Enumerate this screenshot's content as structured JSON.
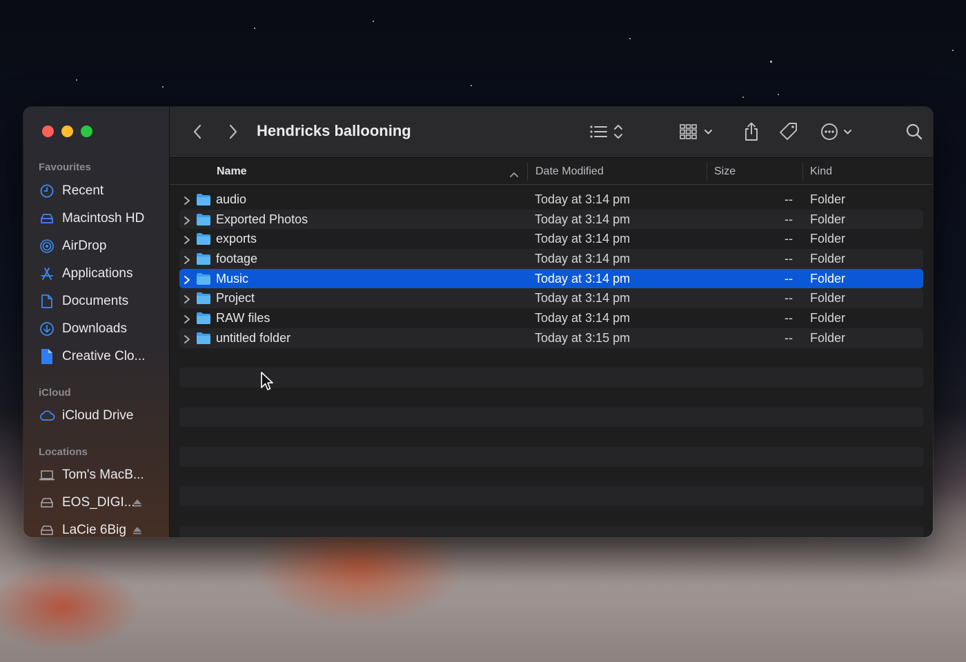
{
  "window": {
    "title": "Hendricks ballooning"
  },
  "sidebar": {
    "sections": [
      {
        "title": "Favourites",
        "items": [
          {
            "label": "Recent",
            "icon": "clock-icon"
          },
          {
            "label": "Macintosh HD",
            "icon": "drive-icon"
          },
          {
            "label": "AirDrop",
            "icon": "airdrop-icon"
          },
          {
            "label": "Applications",
            "icon": "applications-icon"
          },
          {
            "label": "Documents",
            "icon": "document-icon"
          },
          {
            "label": "Downloads",
            "icon": "download-icon"
          },
          {
            "label": "Creative Clo...",
            "icon": "file-icon"
          }
        ]
      },
      {
        "title": "iCloud",
        "items": [
          {
            "label": "iCloud Drive",
            "icon": "cloud-icon"
          }
        ]
      },
      {
        "title": "Locations",
        "items": [
          {
            "label": "Tom's MacB...",
            "icon": "laptop-icon"
          },
          {
            "label": "EOS_DIGI...",
            "icon": "drive-icon",
            "eject": true
          },
          {
            "label": "LaCie 6Big",
            "icon": "drive-icon",
            "eject": true
          }
        ]
      }
    ]
  },
  "columns": {
    "name": "Name",
    "date": "Date Modified",
    "size": "Size",
    "kind": "Kind"
  },
  "files": [
    {
      "name": "audio",
      "date": "Today at 3:14 pm",
      "size": "--",
      "kind": "Folder"
    },
    {
      "name": "Exported Photos",
      "date": "Today at 3:14 pm",
      "size": "--",
      "kind": "Folder"
    },
    {
      "name": "exports",
      "date": "Today at 3:14 pm",
      "size": "--",
      "kind": "Folder"
    },
    {
      "name": "footage",
      "date": "Today at 3:14 pm",
      "size": "--",
      "kind": "Folder"
    },
    {
      "name": "Music",
      "date": "Today at 3:14 pm",
      "size": "--",
      "kind": "Folder",
      "selected": true
    },
    {
      "name": "Project",
      "date": "Today at 3:14 pm",
      "size": "--",
      "kind": "Folder"
    },
    {
      "name": "RAW files",
      "date": "Today at 3:14 pm",
      "size": "--",
      "kind": "Folder"
    },
    {
      "name": "untitled folder",
      "date": "Today at 3:15 pm",
      "size": "--",
      "kind": "Folder"
    }
  ],
  "colors": {
    "selection": "#0a58d6",
    "folder": "#3aa0ee",
    "accent": "#3b8cf5"
  }
}
